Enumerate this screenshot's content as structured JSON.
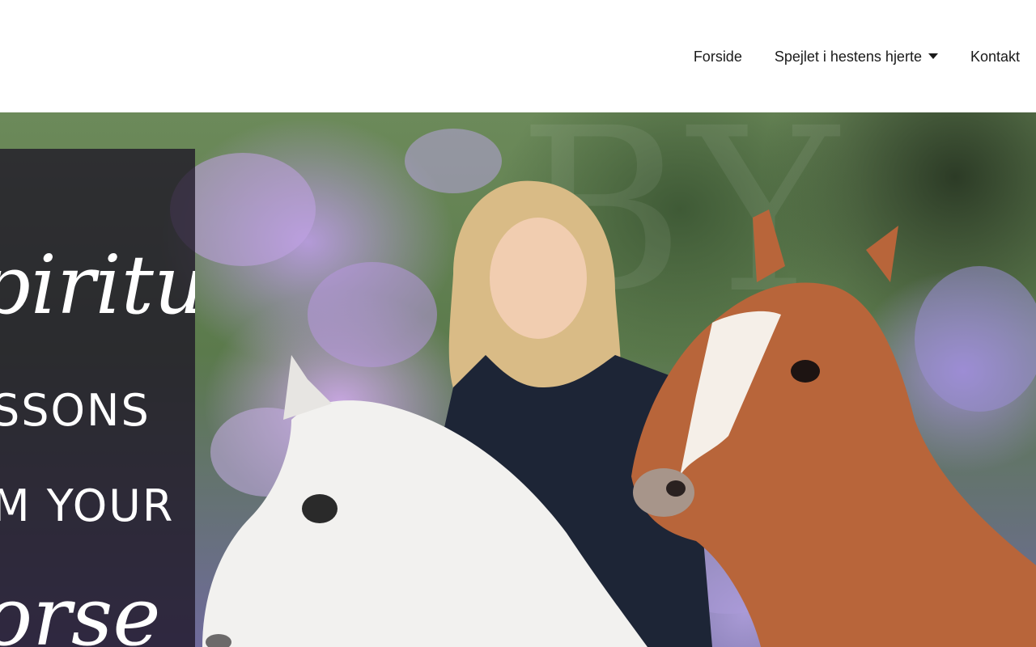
{
  "nav": {
    "items": [
      {
        "label": "Forside"
      },
      {
        "label": "Spejlet i hestens hjerte",
        "has_dropdown": true
      },
      {
        "label": "Kontakt"
      }
    ]
  },
  "hero": {
    "overlay_lines": [
      "piritual",
      "SSONS",
      "M YOUR",
      "orse"
    ],
    "ghost_text": "BY"
  },
  "colors": {
    "nav_text": "#1a1a1a",
    "header_bg": "#ffffff",
    "panel_bg": "rgba(30,22,38,0.78)"
  },
  "icons": {
    "dropdown": "caret-down-icon"
  }
}
